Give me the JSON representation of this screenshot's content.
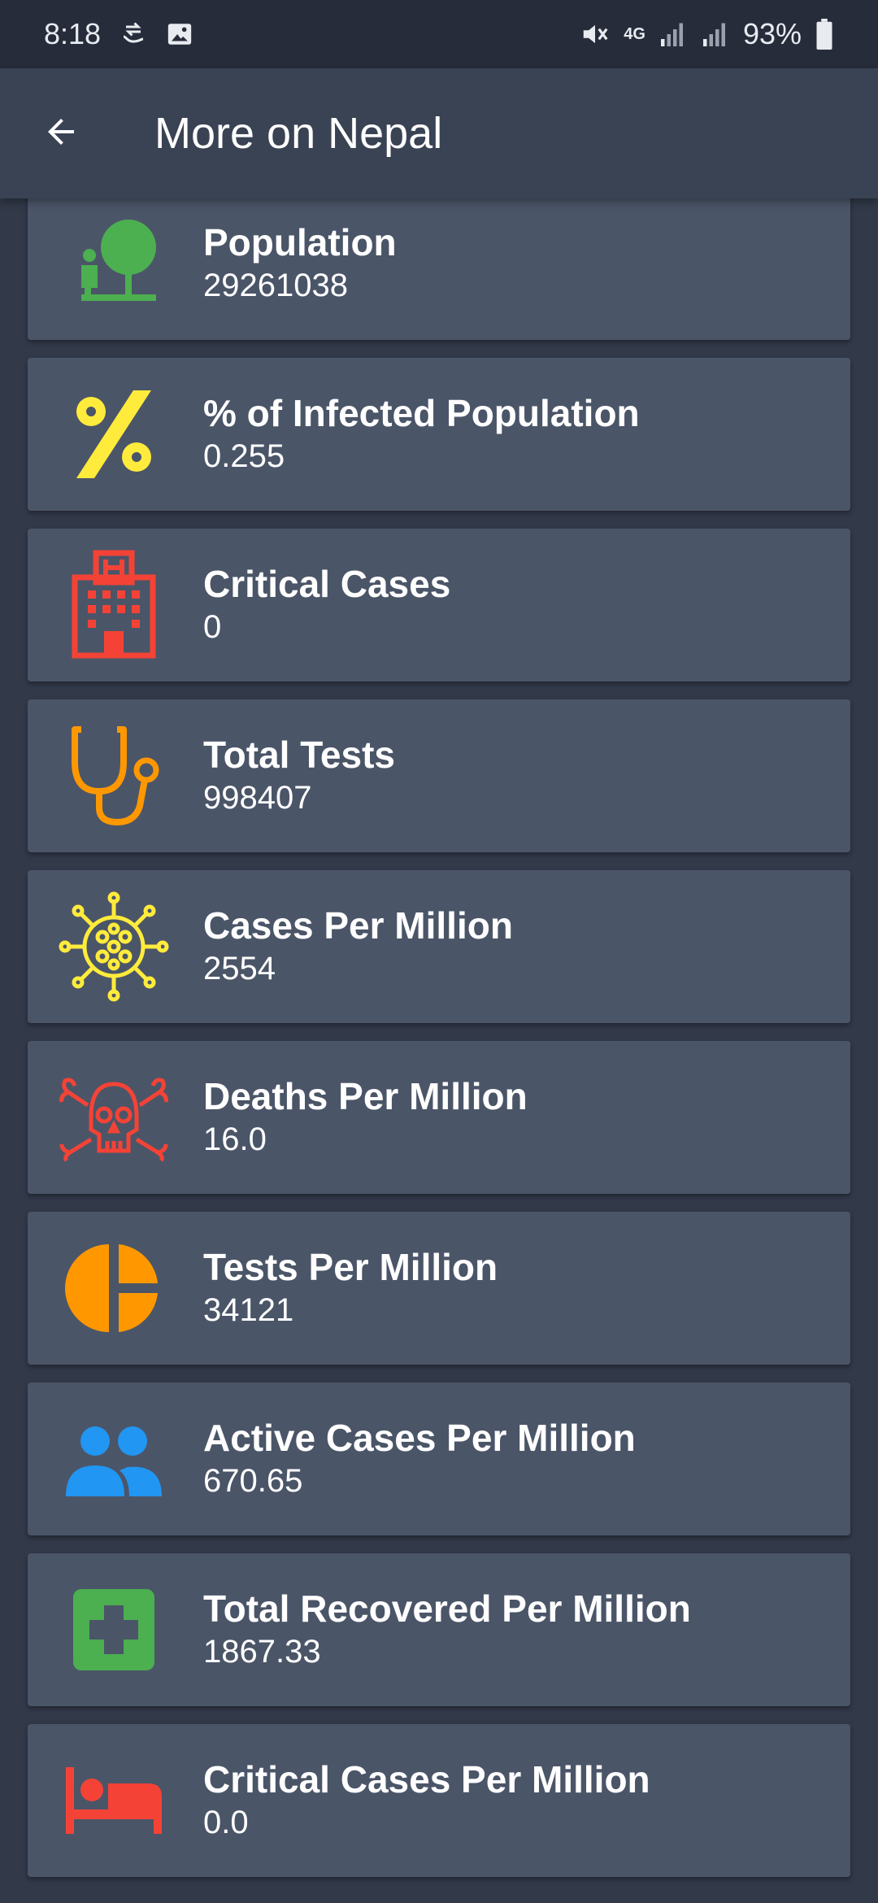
{
  "status_bar": {
    "time": "8:18",
    "battery": "93%",
    "network": "4G"
  },
  "header": {
    "title": "More on Nepal"
  },
  "stats": [
    {
      "label": "Population",
      "value": "29261038",
      "icon": "tree-person-icon",
      "color": "#4caf50"
    },
    {
      "label": "% of Infected Population",
      "value": "0.255",
      "icon": "percent-icon",
      "color": "#ffeb3b"
    },
    {
      "label": "Critical Cases",
      "value": "0",
      "icon": "hospital-icon",
      "color": "#f44336"
    },
    {
      "label": "Total Tests",
      "value": "998407",
      "icon": "stethoscope-icon",
      "color": "#ff9800"
    },
    {
      "label": "Cases Per Million",
      "value": "2554",
      "icon": "virus-icon",
      "color": "#ffeb3b"
    },
    {
      "label": "Deaths Per Million",
      "value": "16.0",
      "icon": "skull-crossbones-icon",
      "color": "#f44336"
    },
    {
      "label": "Tests Per Million",
      "value": "34121",
      "icon": "pie-chart-icon",
      "color": "#ff9800"
    },
    {
      "label": "Active Cases Per Million",
      "value": "670.65",
      "icon": "people-icon",
      "color": "#2196f3"
    },
    {
      "label": "Total Recovered Per Million",
      "value": "1867.33",
      "icon": "medical-cross-icon",
      "color": "#4caf50"
    },
    {
      "label": "Critical Cases Per Million",
      "value": "0.0",
      "icon": "hospital-bed-icon",
      "color": "#f44336"
    }
  ]
}
